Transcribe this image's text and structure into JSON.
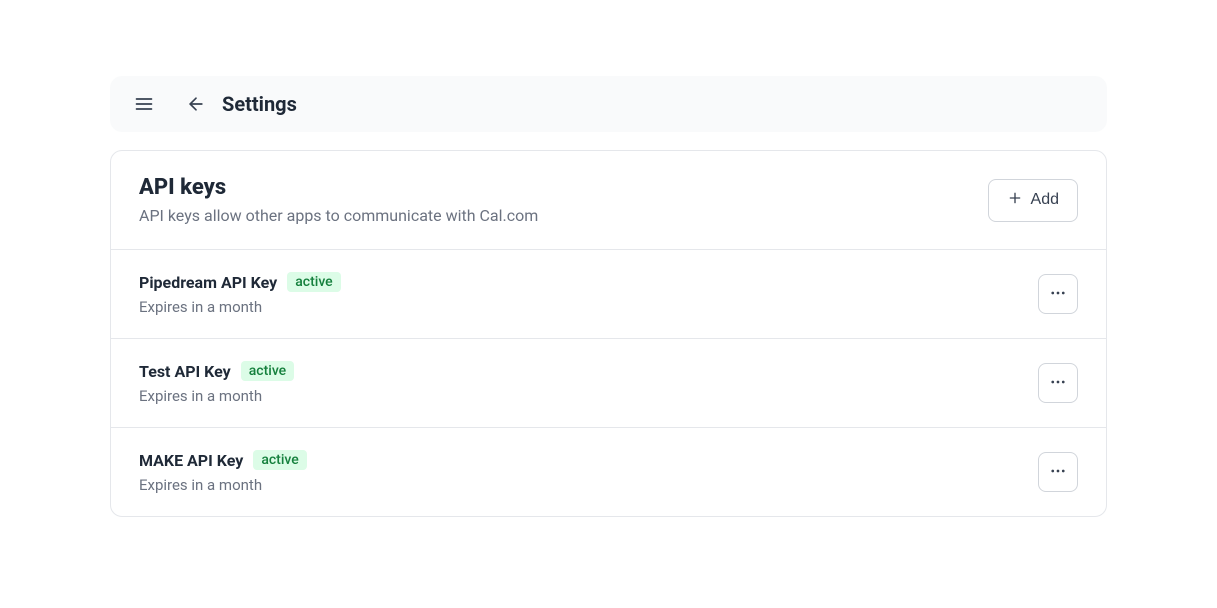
{
  "topbar": {
    "title": "Settings"
  },
  "header": {
    "title": "API keys",
    "subtitle": "API keys allow other apps to communicate with Cal.com",
    "add_label": "Add"
  },
  "keys": [
    {
      "name": "Pipedream API Key",
      "status": "active",
      "expires": "Expires in a month"
    },
    {
      "name": "Test API Key",
      "status": "active",
      "expires": "Expires in a month"
    },
    {
      "name": "MAKE API Key",
      "status": "active",
      "expires": "Expires in a month"
    }
  ]
}
